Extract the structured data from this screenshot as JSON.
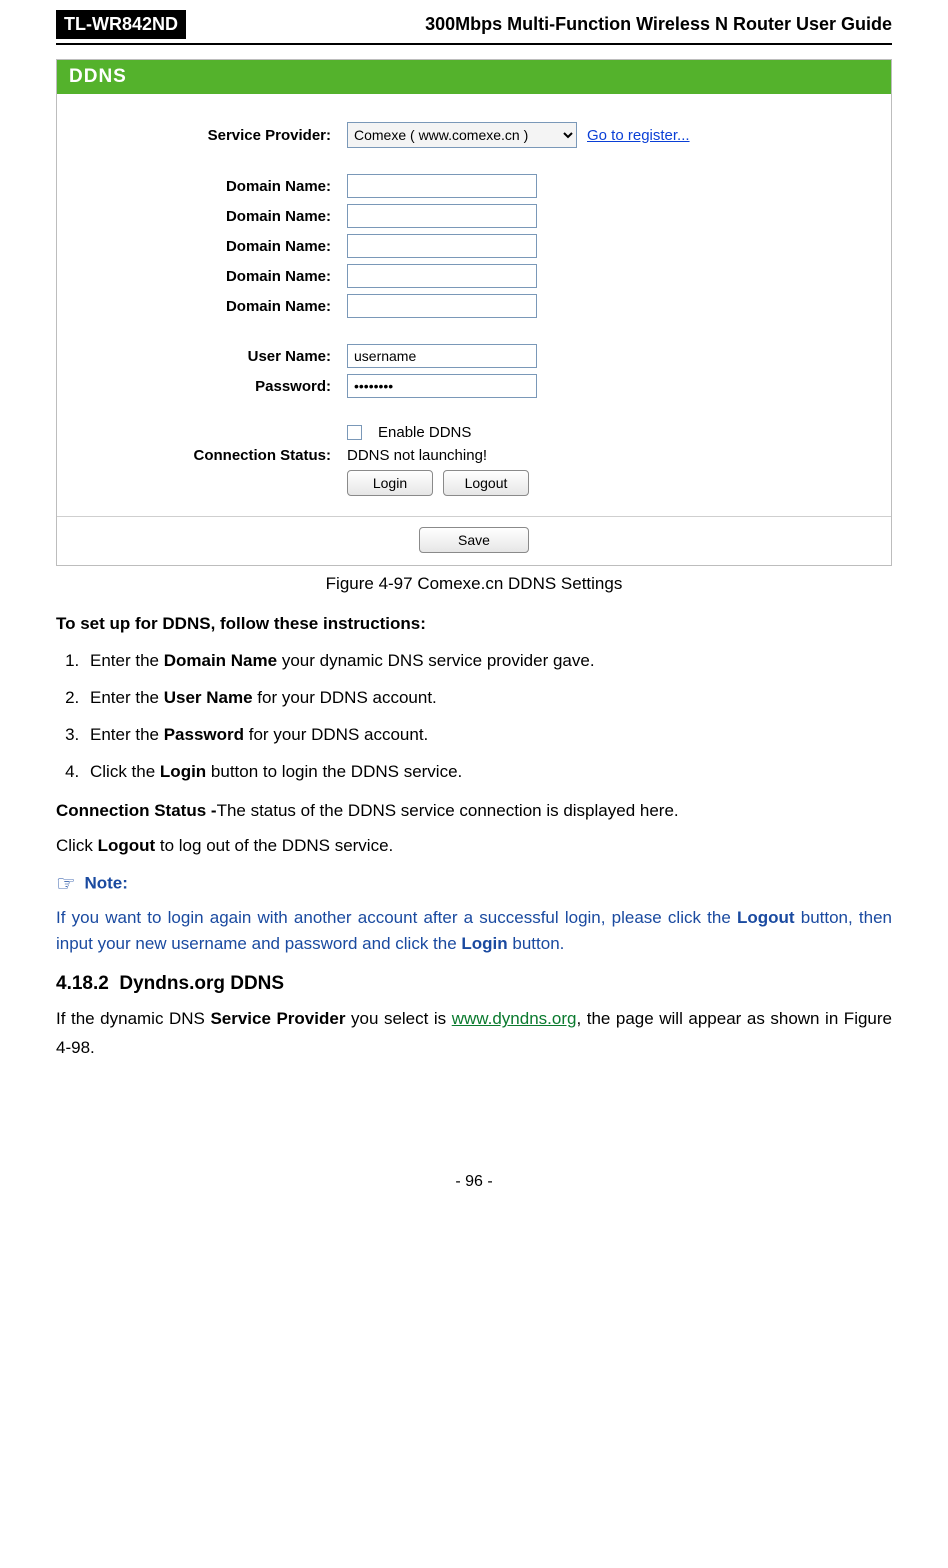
{
  "header": {
    "model": "TL-WR842ND",
    "title": "300Mbps Multi-Function Wireless N Router User Guide"
  },
  "panel": {
    "heading": "DDNS",
    "service_provider_label": "Service Provider:",
    "service_provider_value": "Comexe ( www.comexe.cn )",
    "register_link": "Go to register...",
    "domain_label": "Domain Name:",
    "username_label": "User Name:",
    "username_value": "username",
    "password_label": "Password:",
    "password_value": "••••••••",
    "enable_label": "Enable DDNS",
    "conn_status_label": "Connection Status:",
    "conn_status_value": "DDNS not launching!",
    "login_btn": "Login",
    "logout_btn": "Logout",
    "save_btn": "Save"
  },
  "caption": "Figure 4-97 Comexe.cn DDNS Settings",
  "instructions": {
    "lead": "To set up for DDNS, follow these instructions:",
    "step1_pre": "Enter the ",
    "step1_bold": "Domain Name",
    "step1_post": " your dynamic DNS service provider gave.",
    "step2_pre": "Enter the ",
    "step2_bold": "User Name",
    "step2_post": " for your DDNS account.",
    "step3_pre": "Enter the ",
    "step3_bold": "Password",
    "step3_post": " for your DDNS account.",
    "step4_pre": "Click the ",
    "step4_bold": "Login",
    "step4_post": " button to login the DDNS service."
  },
  "conn_desc": {
    "bold": "Connection Status -",
    "rest": "The status of the DDNS service connection is displayed here."
  },
  "logout_line": {
    "pre": "Click ",
    "bold": "Logout",
    "post": " to log out of the DDNS service."
  },
  "note": {
    "head": "Note:",
    "body_pre": " If you want to login again with another account after a successful login, please click the ",
    "body_b1": "Logout",
    "body_mid": " button, then input your new username and password and click the ",
    "body_b2": "Login",
    "body_post": " button."
  },
  "section": {
    "number": "4.18.2",
    "title": "Dyndns.org DDNS",
    "para_pre": "If the dynamic DNS ",
    "para_b": "Service Provider",
    "para_mid": " you select is ",
    "para_link": "www.dyndns.org",
    "para_post": ", the page will appear as shown in Figure 4-98."
  },
  "page_number": "- 96 -"
}
